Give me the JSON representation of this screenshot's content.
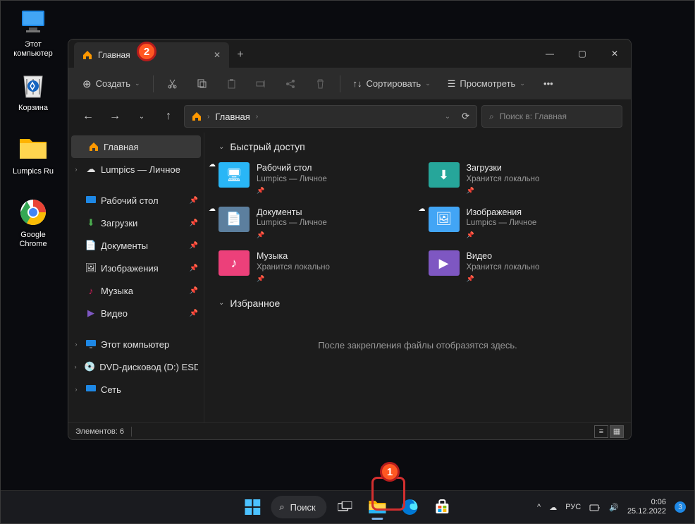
{
  "desktop_icons": [
    {
      "label": "Этот\nкомпьютер"
    },
    {
      "label": "Корзина"
    },
    {
      "label": "Lumpics Ru"
    },
    {
      "label": "Google\nChrome"
    }
  ],
  "window": {
    "tab_title": "Главная",
    "toolbar": {
      "new": "Создать",
      "sort": "Сортировать",
      "view": "Просмотреть"
    },
    "breadcrumb": "Главная",
    "search_placeholder": "Поиск в: Главная",
    "sidebar": {
      "home": "Главная",
      "onedrive": "Lumpics — Личное",
      "quick": [
        {
          "label": "Рабочий стол"
        },
        {
          "label": "Загрузки"
        },
        {
          "label": "Документы"
        },
        {
          "label": "Изображения"
        },
        {
          "label": "Музыка"
        },
        {
          "label": "Видео"
        }
      ],
      "pc": "Этот компьютер",
      "dvd": "DVD-дисковод (D:) ESD-IS",
      "net": "Сеть"
    },
    "sections": {
      "quick": "Быстрый доступ",
      "fav": "Избранное"
    },
    "quick_items": [
      {
        "name": "Рабочий стол",
        "sub": "Lumpics — Личное",
        "cloud": true
      },
      {
        "name": "Загрузки",
        "sub": "Хранится локально"
      },
      {
        "name": "Документы",
        "sub": "Lumpics — Личное",
        "cloud": true
      },
      {
        "name": "Изображения",
        "sub": "Lumpics — Личное",
        "cloud": true
      },
      {
        "name": "Музыка",
        "sub": "Хранится локально"
      },
      {
        "name": "Видео",
        "sub": "Хранится локально"
      }
    ],
    "empty_fav": "После закрепления файлы отобразятся здесь.",
    "status": "Элементов: 6"
  },
  "taskbar": {
    "search": "Поиск",
    "lang": "РУС",
    "time": "0:06",
    "date": "25.12.2022"
  },
  "markers": {
    "1": "1",
    "2": "2",
    "3": "3"
  }
}
